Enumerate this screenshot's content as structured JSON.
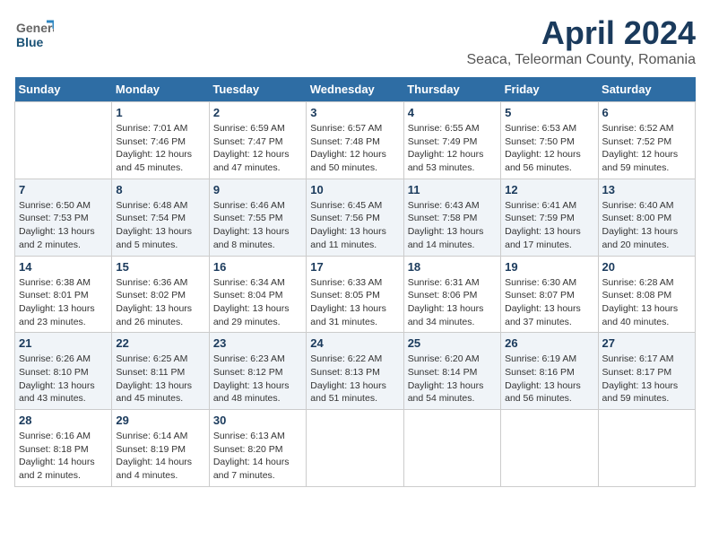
{
  "header": {
    "logo_general": "General",
    "logo_blue": "Blue",
    "title": "April 2024",
    "subtitle": "Seaca, Teleorman County, Romania"
  },
  "days_of_week": [
    "Sunday",
    "Monday",
    "Tuesday",
    "Wednesday",
    "Thursday",
    "Friday",
    "Saturday"
  ],
  "weeks": [
    [
      {
        "day": "",
        "info": ""
      },
      {
        "day": "1",
        "info": "Sunrise: 7:01 AM\nSunset: 7:46 PM\nDaylight: 12 hours\nand 45 minutes."
      },
      {
        "day": "2",
        "info": "Sunrise: 6:59 AM\nSunset: 7:47 PM\nDaylight: 12 hours\nand 47 minutes."
      },
      {
        "day": "3",
        "info": "Sunrise: 6:57 AM\nSunset: 7:48 PM\nDaylight: 12 hours\nand 50 minutes."
      },
      {
        "day": "4",
        "info": "Sunrise: 6:55 AM\nSunset: 7:49 PM\nDaylight: 12 hours\nand 53 minutes."
      },
      {
        "day": "5",
        "info": "Sunrise: 6:53 AM\nSunset: 7:50 PM\nDaylight: 12 hours\nand 56 minutes."
      },
      {
        "day": "6",
        "info": "Sunrise: 6:52 AM\nSunset: 7:52 PM\nDaylight: 12 hours\nand 59 minutes."
      }
    ],
    [
      {
        "day": "7",
        "info": "Sunrise: 6:50 AM\nSunset: 7:53 PM\nDaylight: 13 hours\nand 2 minutes."
      },
      {
        "day": "8",
        "info": "Sunrise: 6:48 AM\nSunset: 7:54 PM\nDaylight: 13 hours\nand 5 minutes."
      },
      {
        "day": "9",
        "info": "Sunrise: 6:46 AM\nSunset: 7:55 PM\nDaylight: 13 hours\nand 8 minutes."
      },
      {
        "day": "10",
        "info": "Sunrise: 6:45 AM\nSunset: 7:56 PM\nDaylight: 13 hours\nand 11 minutes."
      },
      {
        "day": "11",
        "info": "Sunrise: 6:43 AM\nSunset: 7:58 PM\nDaylight: 13 hours\nand 14 minutes."
      },
      {
        "day": "12",
        "info": "Sunrise: 6:41 AM\nSunset: 7:59 PM\nDaylight: 13 hours\nand 17 minutes."
      },
      {
        "day": "13",
        "info": "Sunrise: 6:40 AM\nSunset: 8:00 PM\nDaylight: 13 hours\nand 20 minutes."
      }
    ],
    [
      {
        "day": "14",
        "info": "Sunrise: 6:38 AM\nSunset: 8:01 PM\nDaylight: 13 hours\nand 23 minutes."
      },
      {
        "day": "15",
        "info": "Sunrise: 6:36 AM\nSunset: 8:02 PM\nDaylight: 13 hours\nand 26 minutes."
      },
      {
        "day": "16",
        "info": "Sunrise: 6:34 AM\nSunset: 8:04 PM\nDaylight: 13 hours\nand 29 minutes."
      },
      {
        "day": "17",
        "info": "Sunrise: 6:33 AM\nSunset: 8:05 PM\nDaylight: 13 hours\nand 31 minutes."
      },
      {
        "day": "18",
        "info": "Sunrise: 6:31 AM\nSunset: 8:06 PM\nDaylight: 13 hours\nand 34 minutes."
      },
      {
        "day": "19",
        "info": "Sunrise: 6:30 AM\nSunset: 8:07 PM\nDaylight: 13 hours\nand 37 minutes."
      },
      {
        "day": "20",
        "info": "Sunrise: 6:28 AM\nSunset: 8:08 PM\nDaylight: 13 hours\nand 40 minutes."
      }
    ],
    [
      {
        "day": "21",
        "info": "Sunrise: 6:26 AM\nSunset: 8:10 PM\nDaylight: 13 hours\nand 43 minutes."
      },
      {
        "day": "22",
        "info": "Sunrise: 6:25 AM\nSunset: 8:11 PM\nDaylight: 13 hours\nand 45 minutes."
      },
      {
        "day": "23",
        "info": "Sunrise: 6:23 AM\nSunset: 8:12 PM\nDaylight: 13 hours\nand 48 minutes."
      },
      {
        "day": "24",
        "info": "Sunrise: 6:22 AM\nSunset: 8:13 PM\nDaylight: 13 hours\nand 51 minutes."
      },
      {
        "day": "25",
        "info": "Sunrise: 6:20 AM\nSunset: 8:14 PM\nDaylight: 13 hours\nand 54 minutes."
      },
      {
        "day": "26",
        "info": "Sunrise: 6:19 AM\nSunset: 8:16 PM\nDaylight: 13 hours\nand 56 minutes."
      },
      {
        "day": "27",
        "info": "Sunrise: 6:17 AM\nSunset: 8:17 PM\nDaylight: 13 hours\nand 59 minutes."
      }
    ],
    [
      {
        "day": "28",
        "info": "Sunrise: 6:16 AM\nSunset: 8:18 PM\nDaylight: 14 hours\nand 2 minutes."
      },
      {
        "day": "29",
        "info": "Sunrise: 6:14 AM\nSunset: 8:19 PM\nDaylight: 14 hours\nand 4 minutes."
      },
      {
        "day": "30",
        "info": "Sunrise: 6:13 AM\nSunset: 8:20 PM\nDaylight: 14 hours\nand 7 minutes."
      },
      {
        "day": "",
        "info": ""
      },
      {
        "day": "",
        "info": ""
      },
      {
        "day": "",
        "info": ""
      },
      {
        "day": "",
        "info": ""
      }
    ]
  ]
}
